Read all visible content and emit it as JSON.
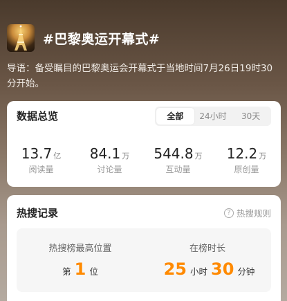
{
  "header": {
    "title": "#巴黎奥运开幕式#"
  },
  "guide": {
    "text": "导语：备受瞩目的巴黎奥运会开幕式于当地时间7月26日19时30分开始。"
  },
  "overview": {
    "title": "数据总览",
    "tabs": [
      {
        "label": "全部",
        "active": true
      },
      {
        "label": "24小时",
        "active": false
      },
      {
        "label": "30天",
        "active": false
      }
    ],
    "stats": [
      {
        "value": "13.7",
        "unit": "亿",
        "label": "阅读量"
      },
      {
        "value": "84.1",
        "unit": "万",
        "label": "讨论量"
      },
      {
        "value": "544.8",
        "unit": "万",
        "label": "互动量"
      },
      {
        "value": "12.2",
        "unit": "万",
        "label": "原创量"
      }
    ]
  },
  "hot": {
    "title": "热搜记录",
    "rules_label": "热搜规则",
    "rules_icon_glyph": "?",
    "highest": {
      "label": "热搜榜最高位置",
      "prefix": "第",
      "number": "1",
      "suffix": "位"
    },
    "duration": {
      "label": "在榜时长",
      "hours": "25",
      "hours_unit": "小时",
      "minutes": "30",
      "minutes_unit": "分钟"
    }
  },
  "colors": {
    "accent": "#ff8a00",
    "card_bg": "#ffffff"
  }
}
